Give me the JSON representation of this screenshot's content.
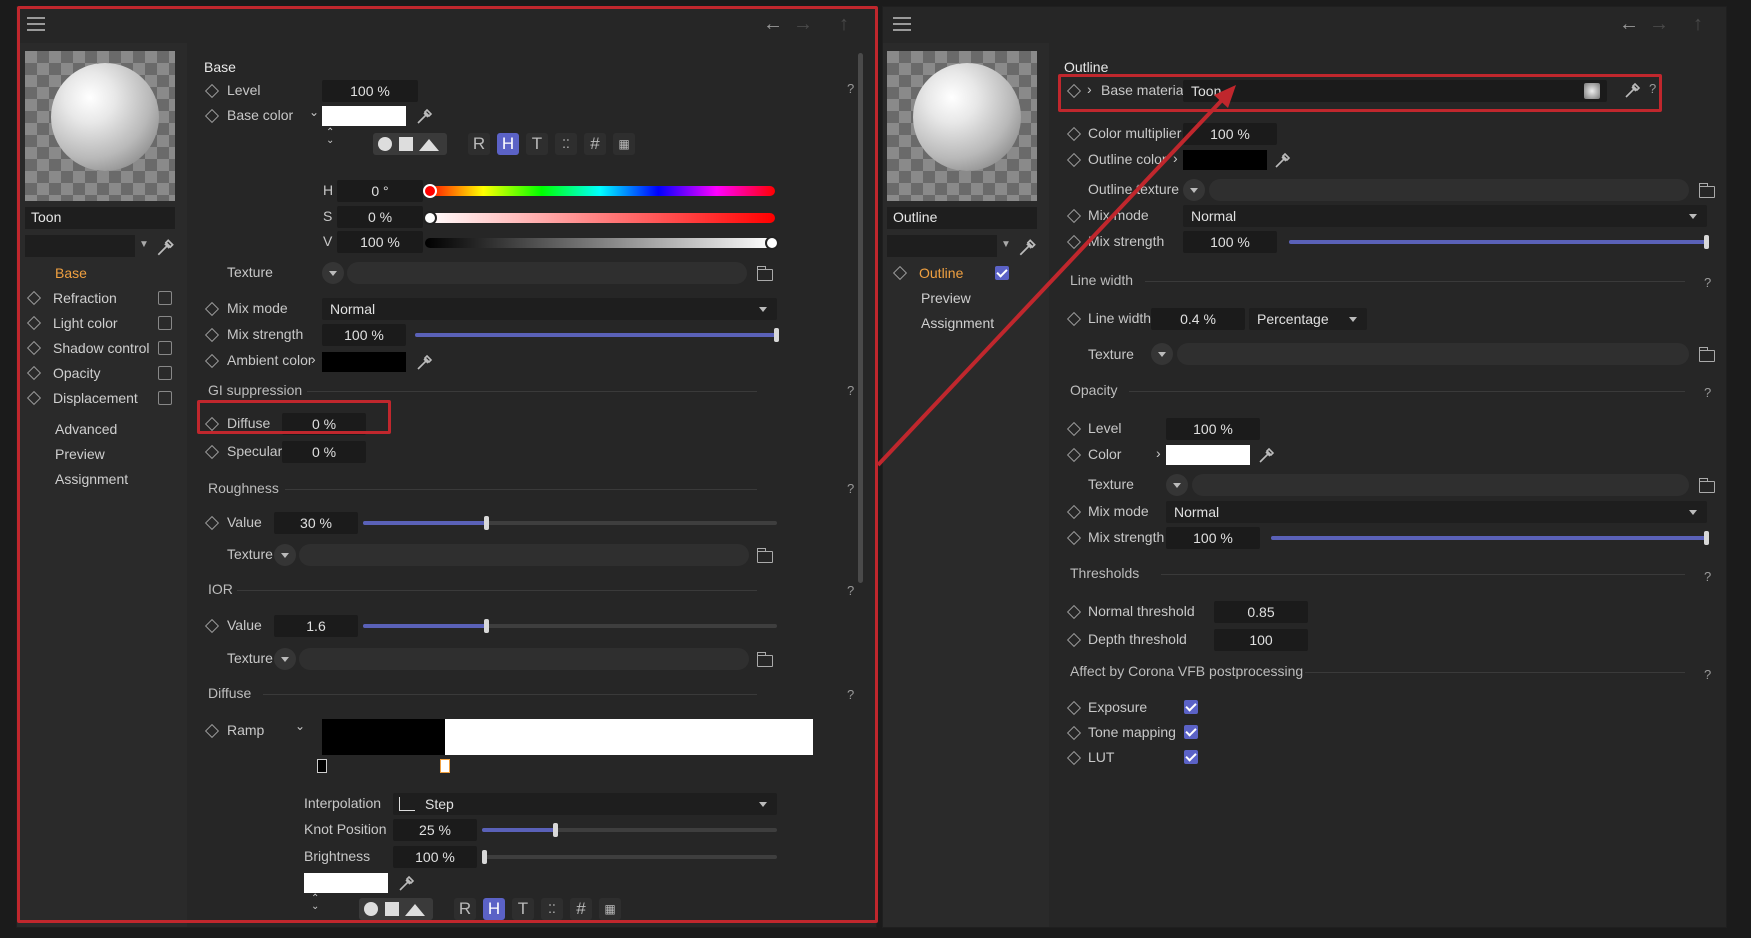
{
  "left": {
    "material_name": "Toon",
    "sidebar": [
      {
        "label": "Base",
        "active": true,
        "diamond": false,
        "checkbox": false
      },
      {
        "label": "Refraction",
        "diamond": true,
        "checkbox": true
      },
      {
        "label": "Light color",
        "diamond": true,
        "checkbox": true
      },
      {
        "label": "Shadow control",
        "diamond": true,
        "checkbox": true
      },
      {
        "label": "Opacity",
        "diamond": true,
        "checkbox": true
      },
      {
        "label": "Displacement",
        "diamond": true,
        "checkbox": true
      },
      {
        "label": "Advanced",
        "diamond": false,
        "checkbox": false
      },
      {
        "label": "Preview",
        "diamond": false,
        "checkbox": false
      },
      {
        "label": "Assignment",
        "diamond": false,
        "checkbox": false
      }
    ],
    "base_title": "Base",
    "level_label": "Level",
    "level_value": "100 %",
    "base_color_label": "Base color",
    "color_modes": [
      "R",
      "H",
      "T",
      "#"
    ],
    "h_label": "H",
    "h_value": "0 °",
    "s_label": "S",
    "s_value": "0 %",
    "v_label": "V",
    "v_value": "100 %",
    "texture_label": "Texture",
    "mix_mode_label": "Mix mode",
    "mix_mode_value": "Normal",
    "mix_strength_label": "Mix strength",
    "mix_strength_value": "100 %",
    "mix_strength_level": 1.0,
    "ambient_label": "Ambient color",
    "gi_title": "GI suppression",
    "diffuse_label": "Diffuse",
    "diffuse_value": "0 %",
    "specular_label": "Specular",
    "specular_value": "0 %",
    "roughness_title": "Roughness",
    "rough_value_label": "Value",
    "rough_value": "30 %",
    "rough_level": 0.3,
    "ior_title": "IOR",
    "ior_value_label": "Value",
    "ior_value": "1.6",
    "ior_level": 0.3,
    "diffuse_title": "Diffuse",
    "ramp_label": "Ramp",
    "interp_label": "Interpolation",
    "interp_value": "Step",
    "knot_label": "Knot Position",
    "knot_value": "25 %",
    "knot_level": 0.25,
    "bright_label": "Brightness",
    "bright_value": "100 %",
    "bright_level": 0.0,
    "help": "?"
  },
  "right": {
    "material_name": "Outline",
    "sidebar": [
      {
        "label": "Outline",
        "active": true,
        "diamond": true,
        "checkbox": true,
        "checked": true
      },
      {
        "label": "Preview"
      },
      {
        "label": "Assignment"
      }
    ],
    "outline_title": "Outline",
    "base_material_label": "Base material",
    "base_material_value": "Toon",
    "color_mult_label": "Color multiplier",
    "color_mult_value": "100 %",
    "outline_color_label": "Outline color",
    "outline_texture_label": "Outline texture",
    "mix_mode_label": "Mix mode",
    "mix_mode_value": "Normal",
    "mix_strength_label": "Mix strength",
    "mix_strength_value": "100 %",
    "mix_strength_level": 1.0,
    "line_width_title": "Line width",
    "line_width_label": "Line width",
    "line_width_value": "0.4 %",
    "line_width_unit": "Percentage",
    "texture_label": "Texture",
    "opacity_title": "Opacity",
    "level_label": "Level",
    "level_value": "100 %",
    "color_label": "Color",
    "op_texture_label": "Texture",
    "op_mix_mode_label": "Mix mode",
    "op_mix_mode_value": "Normal",
    "op_mix_strength_label": "Mix strength",
    "op_mix_strength_value": "100 %",
    "op_mix_strength_level": 1.0,
    "thresholds_title": "Thresholds",
    "normal_thr_label": "Normal threshold",
    "normal_thr_value": "0.85",
    "depth_thr_label": "Depth threshold",
    "depth_thr_value": "100",
    "vfb_title": "Affect by Corona VFB postprocessing",
    "exposure_label": "Exposure",
    "tone_label": "Tone mapping",
    "lut_label": "LUT",
    "help": "?"
  },
  "colors": {
    "accent": "#5b62c6",
    "highlight_red": "#c0272d",
    "active_orange": "#f0a040"
  }
}
